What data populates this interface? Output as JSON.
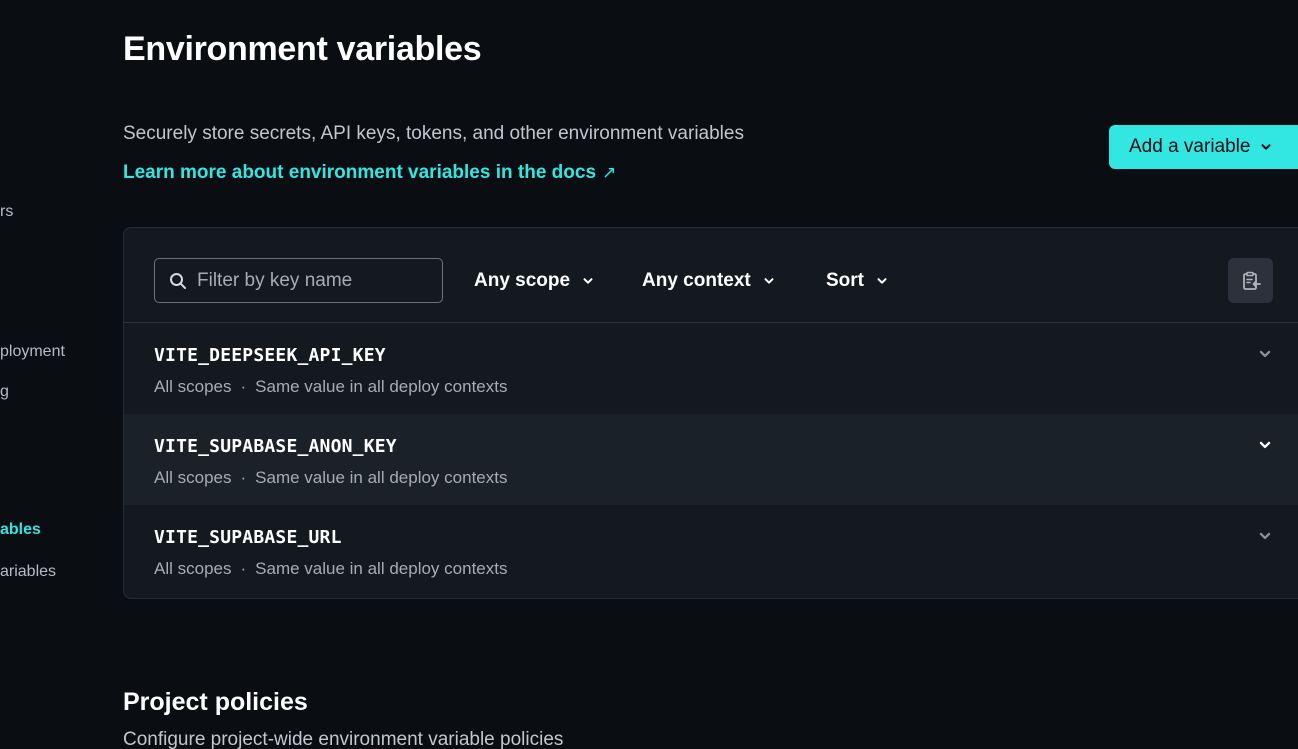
{
  "sidebar": {
    "items": [
      {
        "label": "rs"
      },
      {
        "label": "ployment"
      },
      {
        "label": "g"
      },
      {
        "label": "ables"
      },
      {
        "label": "ariables"
      }
    ]
  },
  "header": {
    "title": "Environment variables",
    "subtitle": "Securely store secrets, API keys, tokens, and other environment variables",
    "docs_link": "Learn more about environment variables in the docs",
    "docs_arrow": "↗",
    "add_button": "Add a variable"
  },
  "filters": {
    "search_placeholder": "Filter by key name",
    "scope": "Any scope",
    "context": "Any context",
    "sort": "Sort"
  },
  "variables": [
    {
      "key": "VITE_DEEPSEEK_API_KEY",
      "scope": "All scopes",
      "separator": "·",
      "context": "Same value in all deploy contexts"
    },
    {
      "key": "VITE_SUPABASE_ANON_KEY",
      "scope": "All scopes",
      "separator": "·",
      "context": "Same value in all deploy contexts"
    },
    {
      "key": "VITE_SUPABASE_URL",
      "scope": "All scopes",
      "separator": "·",
      "context": "Same value in all deploy contexts"
    }
  ],
  "policies": {
    "title": "Project policies",
    "subtitle": "Configure project-wide environment variable policies"
  },
  "colors": {
    "accent": "#32e6e2",
    "background": "#0a0d11",
    "panel": "#141920"
  },
  "icons": {
    "search": "search-icon",
    "chevron": "chevron-down-icon",
    "clipboard": "clipboard-import-icon",
    "external": "external-link-arrow-icon"
  }
}
